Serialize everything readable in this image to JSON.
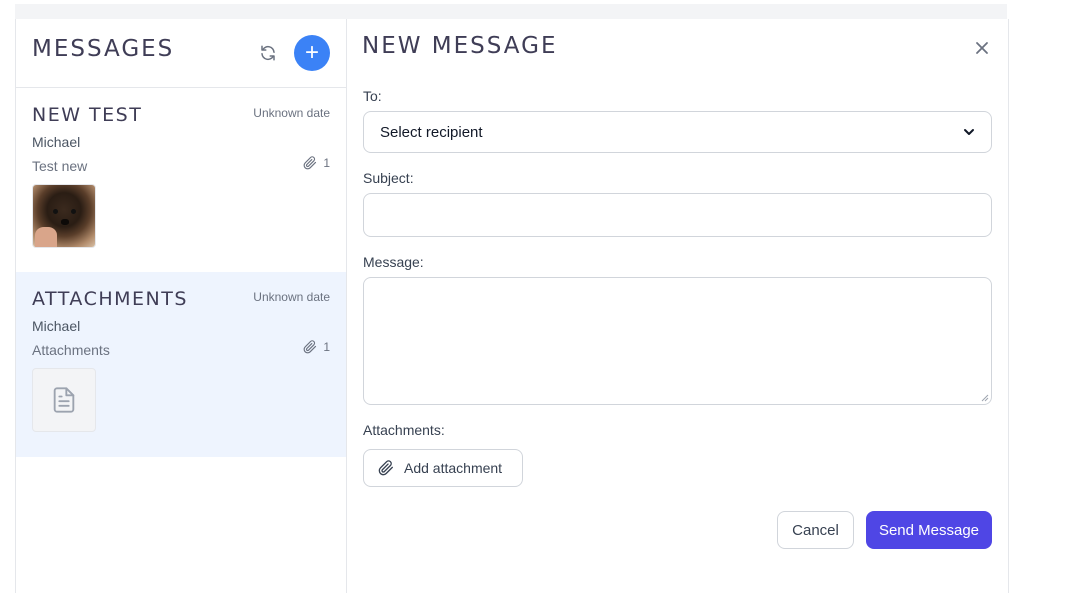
{
  "sidebar": {
    "title": "MESSAGES",
    "refresh_icon": "refresh-icon",
    "new_icon": "plus-icon",
    "new_label": "+",
    "accent": "#3b82f6",
    "selected_bg": "#eef4fe",
    "messages": [
      {
        "subject": "NEW TEST",
        "date": "Unknown date",
        "sender": "Michael",
        "preview": "Test new",
        "attachment_count": "1",
        "attachment_kind": "image"
      },
      {
        "subject": "ATTACHMENTS",
        "date": "Unknown date",
        "sender": "Michael",
        "preview": "Attachments",
        "attachment_count": "1",
        "attachment_kind": "document"
      }
    ]
  },
  "compose": {
    "title": "NEW MESSAGE",
    "close_icon": "close-icon",
    "to_label": "To:",
    "to_value": "Select recipient",
    "subject_label": "Subject:",
    "subject_value": "",
    "message_label": "Message:",
    "message_value": "",
    "attachments_label": "Attachments:",
    "add_attachment_label": "Add attachment",
    "cancel_label": "Cancel",
    "send_label": "Send Message",
    "send_color": "#4f46e5"
  }
}
